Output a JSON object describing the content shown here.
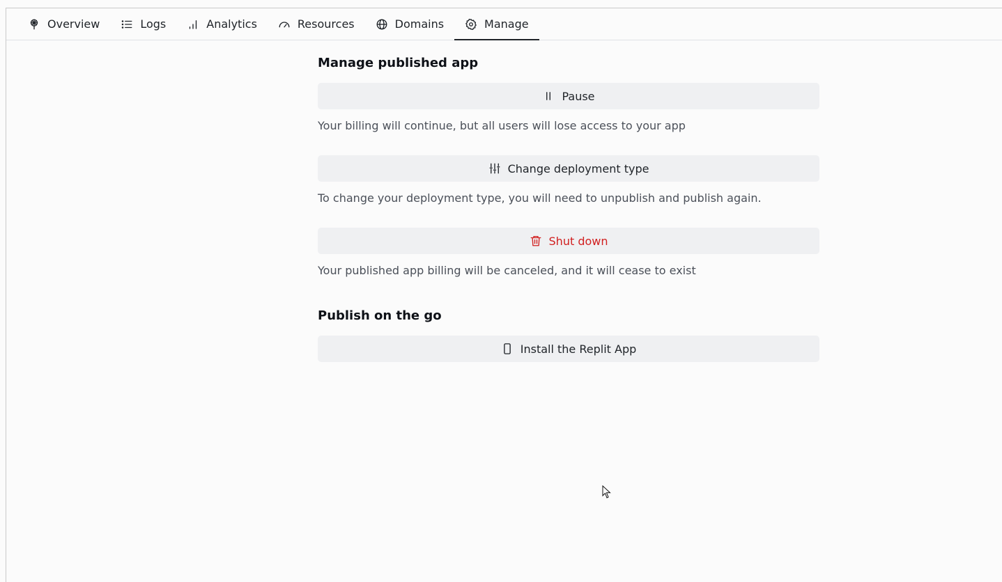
{
  "tabs": [
    {
      "label": "Overview",
      "icon": "deploy-icon",
      "active": false
    },
    {
      "label": "Logs",
      "icon": "list-icon",
      "active": false
    },
    {
      "label": "Analytics",
      "icon": "bar-chart-icon",
      "active": false
    },
    {
      "label": "Resources",
      "icon": "gauge-icon",
      "active": false
    },
    {
      "label": "Domains",
      "icon": "globe-icon",
      "active": false
    },
    {
      "label": "Manage",
      "icon": "gear-icon",
      "active": true
    }
  ],
  "manage": {
    "title": "Manage published app",
    "pause": {
      "label": "Pause",
      "icon": "pause-icon",
      "description": "Your billing will continue, but all users will lose access to your app"
    },
    "change_type": {
      "label": "Change deployment type",
      "icon": "sliders-icon",
      "description": "To change your deployment type, you will need to unpublish and publish again."
    },
    "shutdown": {
      "label": "Shut down",
      "icon": "trash-icon",
      "color": "#d11f1f",
      "description": "Your published app billing will be canceled, and it will cease to exist"
    }
  },
  "publish": {
    "title": "Publish on the go",
    "install": {
      "label": "Install the Replit App",
      "icon": "phone-icon"
    }
  },
  "colors": {
    "background": "#fbfbfb",
    "button_bg": "#eff0f2",
    "danger": "#d11f1f"
  }
}
